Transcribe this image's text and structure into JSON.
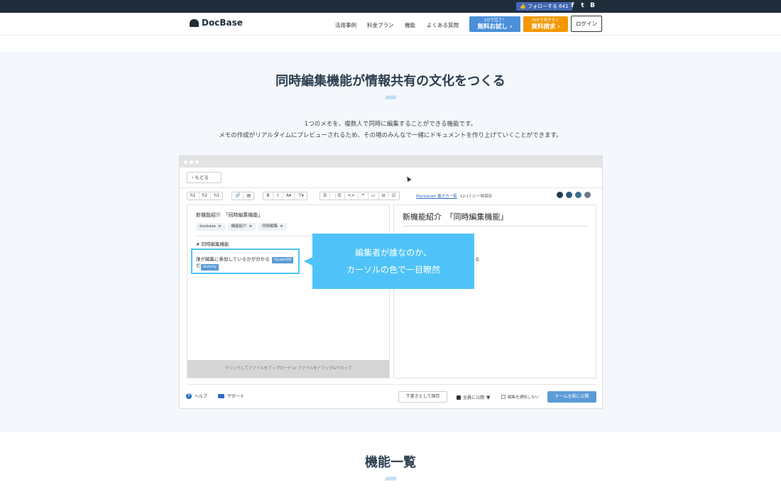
{
  "topbar": {
    "fb_follow": "フォローする 641"
  },
  "header": {
    "logo": "DocBase",
    "nav": [
      "活用事例",
      "料金プラン",
      "機能",
      "よくある質問"
    ],
    "cta_trial_small": "1分で完了！",
    "cta_trial_big": "無料お試し ›",
    "cta_doc_small": "PDFで見やすく",
    "cta_doc_big": "資料請求 ›",
    "login": "ログイン"
  },
  "section": {
    "title": "同時編集機能が情報共有の文化をつくる",
    "deco": "///////////////",
    "desc_line1": "1つのメモを、複数人で同時に編集することができる機能です。",
    "desc_line2": "メモの作成がリアルタイムにプレビューされるため、その場のみんなで一緒にドキュメントを作り上げていくことができます。"
  },
  "editor": {
    "back": "‹  もどる",
    "toolbar": {
      "headings": [
        "h1",
        "h2",
        "h3"
      ],
      "attach": [
        "🔗",
        "▤"
      ],
      "format": [
        "B",
        "I",
        "A▾",
        "·T▾"
      ],
      "blocks": [
        "☰",
        "⋮☰",
        "<>",
        "❝",
        "▭",
        "⊟",
        "☑"
      ]
    },
    "markdown_link": "Markdown 書き方一覧",
    "saved_at": "12:17 に一時保存",
    "memo_title": "新機能紹介　「同時編集機能」",
    "tags": [
      "docbase",
      "機能紹介",
      "同時編集"
    ],
    "tag_remove": "×",
    "heading_md": "# 同時編集機能",
    "edit_line1": "誰が編集に参加しているかが分かる",
    "edit_line2": "だ",
    "cursor_user1": "hiyoshi09",
    "cursor_user2": "dummy",
    "upload_hint": "クリックしてファイルをアップロード or ファイルをドラッグ&ドロップ",
    "preview_title": "新機能紹介　「同時編集機能」",
    "preview_fragment": "る",
    "help": "ヘルプ",
    "support": "サポート",
    "draft": "下書きとして保存",
    "visibility": "全員に公開",
    "visibility_caret": "▼",
    "notify": "編集を通知しない",
    "publish": "チーム全員に公開",
    "avatar_colors": [
      "#1f3b4d",
      "#2a5a7a",
      "#3b6e8f",
      "#6b7b8a"
    ]
  },
  "callout": {
    "line1": "編集者が誰なのか、",
    "line2": "カーソルの色で一目瞭然"
  },
  "section2": {
    "title": "機能一覧",
    "deco": "///////////////"
  }
}
